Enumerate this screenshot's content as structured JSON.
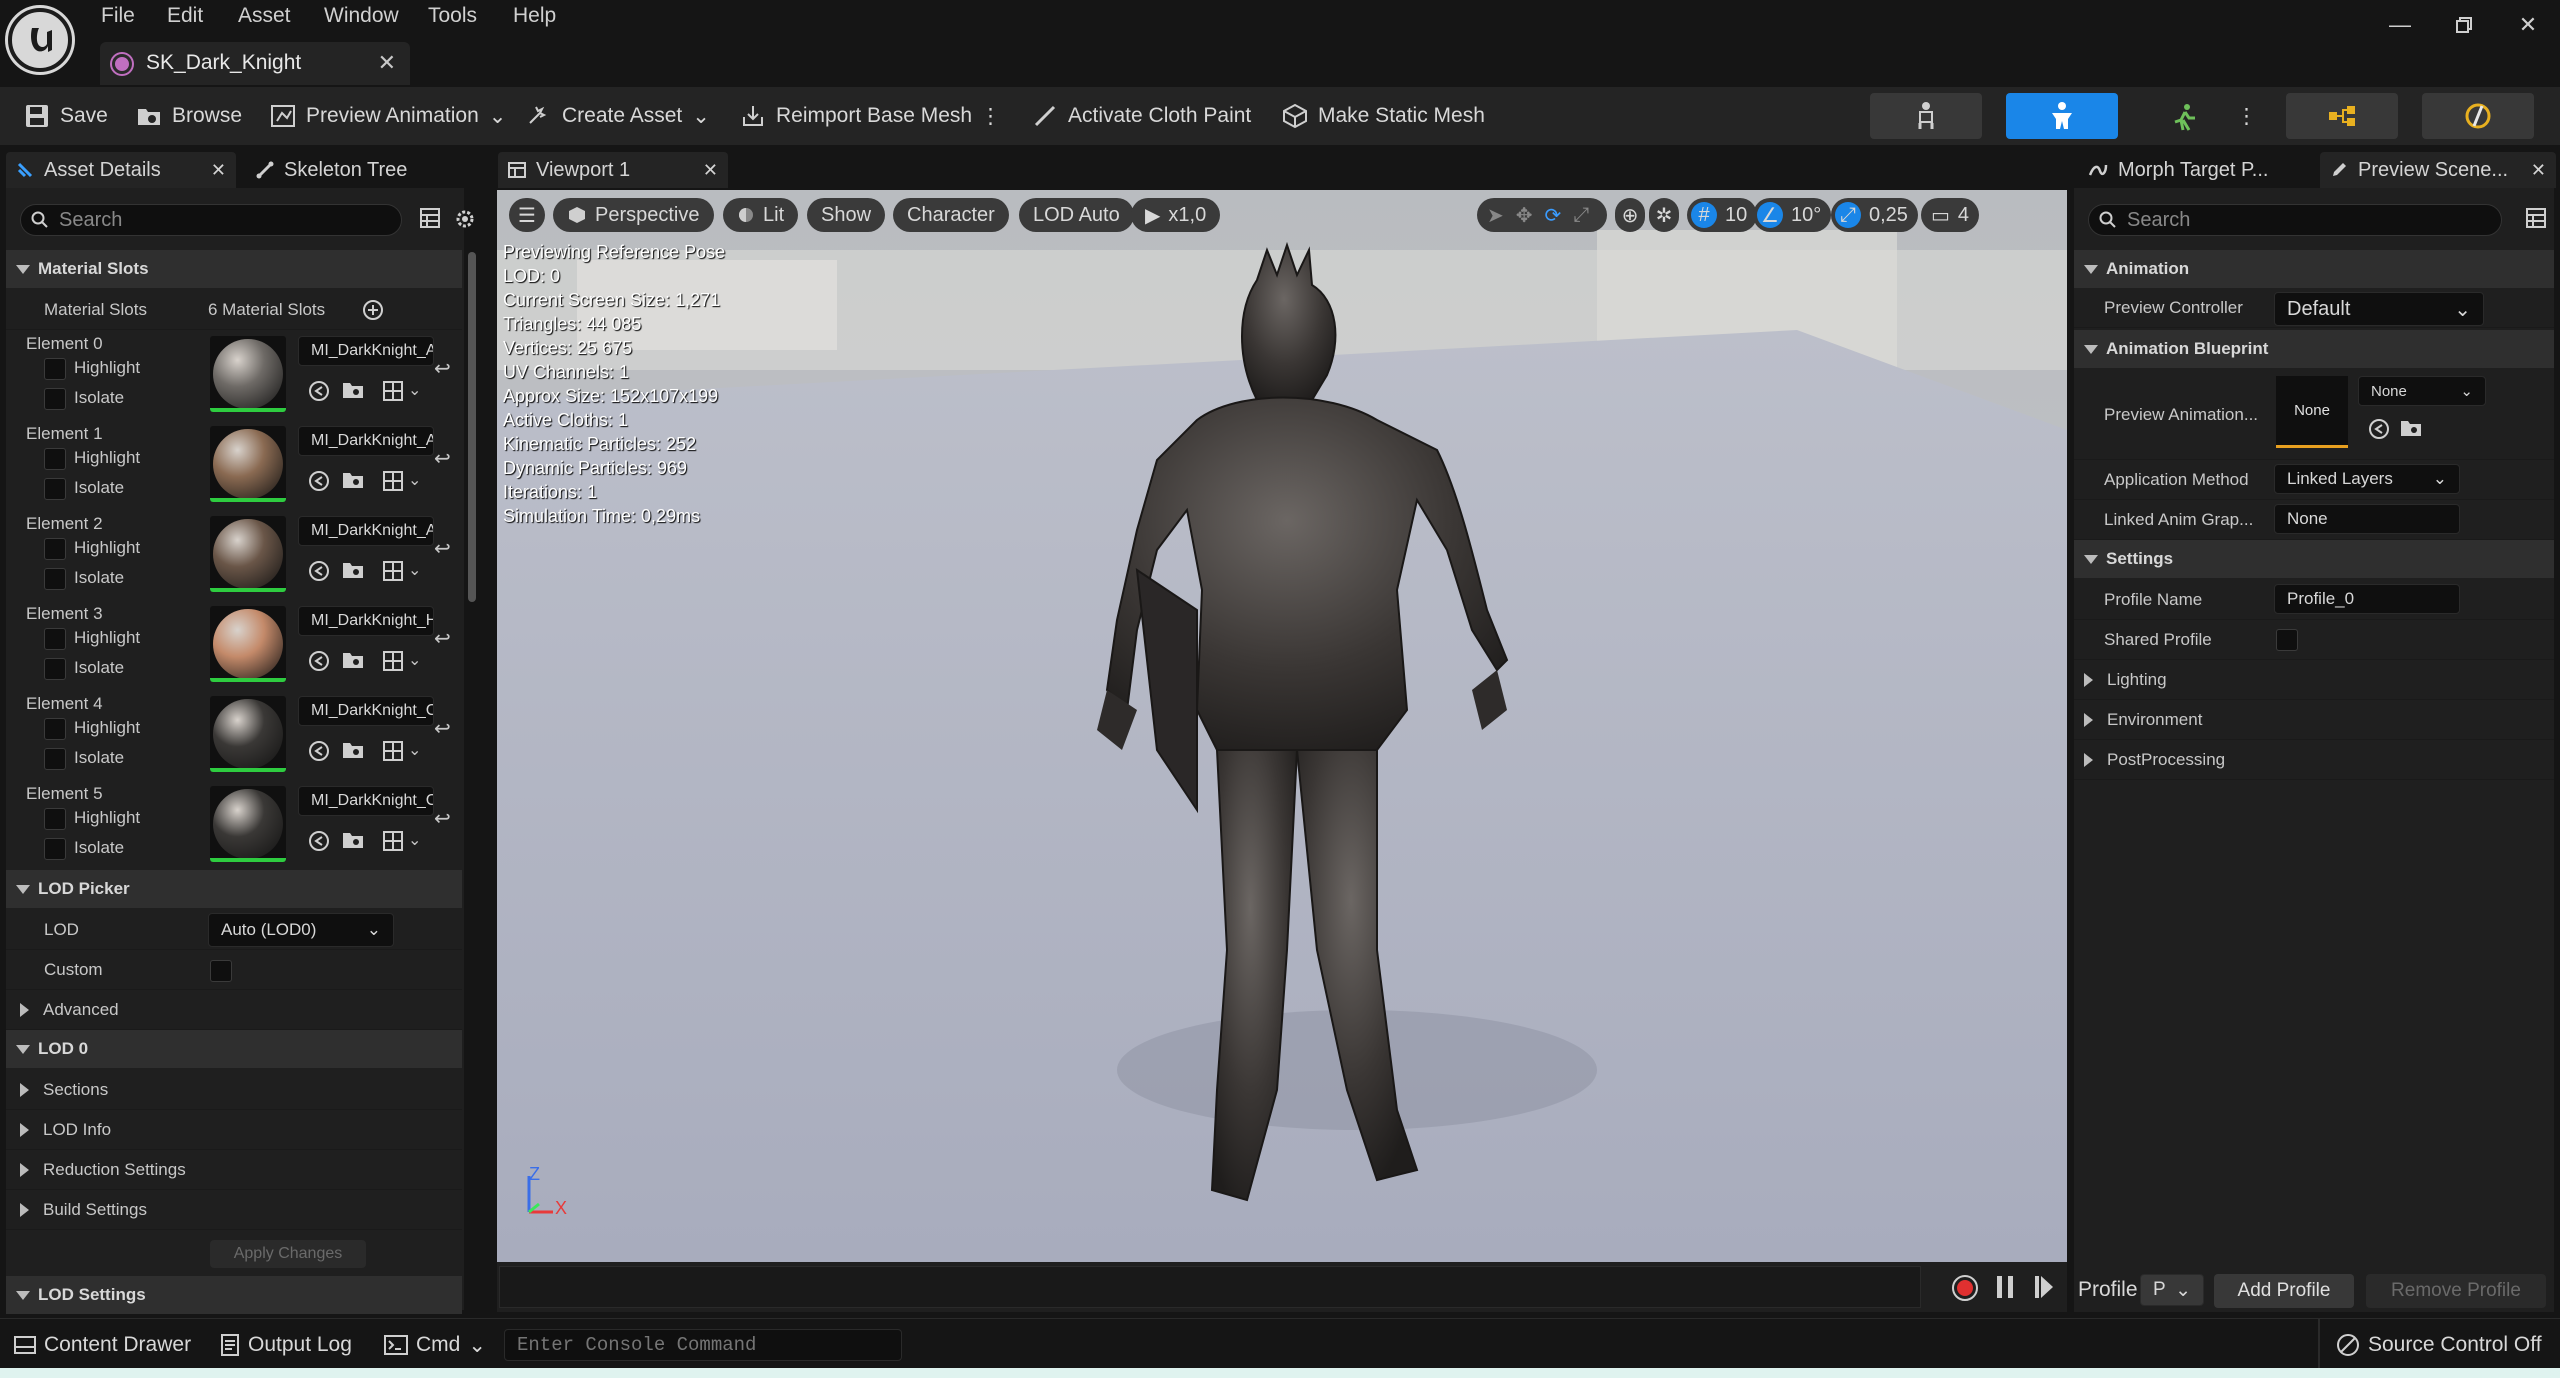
{
  "menu": [
    "File",
    "Edit",
    "Asset",
    "Window",
    "Tools",
    "Help"
  ],
  "document_tab": "SK_Dark_Knight",
  "toolbar": {
    "save": "Save",
    "browse": "Browse",
    "preview_animation": "Preview Animation",
    "create_asset": "Create Asset",
    "reimport": "Reimport Base Mesh",
    "cloth_paint": "Activate Cloth Paint",
    "static_mesh": "Make Static Mesh"
  },
  "left_panel": {
    "tabs": [
      "Asset Details",
      "Skeleton Tree"
    ],
    "search_placeholder": "Search",
    "material_slots_header": "Material Slots",
    "material_slots_label": "Material Slots",
    "material_slots_count": "6 Material Slots",
    "highlight": "Highlight",
    "isolate": "Isolate",
    "elements": [
      {
        "name": "Element 0",
        "material": "MI_DarkKnight_A"
      },
      {
        "name": "Element 1",
        "material": "MI_DarkKnight_A"
      },
      {
        "name": "Element 2",
        "material": "MI_DarkKnight_A"
      },
      {
        "name": "Element 3",
        "material": "MI_DarkKnight_H"
      },
      {
        "name": "Element 4",
        "material": "MI_DarkKnight_C"
      },
      {
        "name": "Element 5",
        "material": "MI_DarkKnight_C"
      }
    ],
    "lod_picker_header": "LOD Picker",
    "lod_label": "LOD",
    "lod_value": "Auto (LOD0)",
    "custom_label": "Custom",
    "advanced": "Advanced",
    "lod0_header": "LOD 0",
    "lod0_rows": [
      "Sections",
      "LOD Info",
      "Reduction Settings",
      "Build Settings"
    ],
    "apply_changes": "Apply Changes",
    "lod_settings_header": "LOD Settings"
  },
  "viewport": {
    "tab": "Viewport 1",
    "perspective": "Perspective",
    "lit": "Lit",
    "show": "Show",
    "character": "Character",
    "lod_auto": "LOD Auto",
    "play_speed": "x1,0",
    "grid_size": "10",
    "rotation_snap": "10°",
    "scale_snap": "0,25",
    "camera_speed": "4",
    "stats": [
      "Previewing Reference Pose",
      "LOD: 0",
      "Current Screen Size: 1,271",
      "Triangles: 44 085",
      "Vertices: 25 675",
      "UV Channels: 1",
      "Approx Size: 152x107x199",
      "Active Cloths: 1",
      "Kinematic Particles: 252",
      "Dynamic Particles: 969",
      "Iterations: 1",
      "Simulation Time: 0,29ms"
    ],
    "axis_z": "Z",
    "axis_x": "X"
  },
  "right_panel": {
    "tabs": [
      "Morph Target P...",
      "Preview Scene..."
    ],
    "search_placeholder": "Search",
    "animation_header": "Animation",
    "preview_controller_label": "Preview Controller",
    "preview_controller_value": "Default",
    "anim_bp_header": "Animation Blueprint",
    "preview_animation_label": "Preview Animation...",
    "preview_animation_thumb": "None",
    "preview_animation_value": "None",
    "application_method_label": "Application Method",
    "application_method_value": "Linked Layers",
    "linked_anim_label": "Linked Anim Grap...",
    "linked_anim_value": "None",
    "settings_header": "Settings",
    "profile_name_label": "Profile Name",
    "profile_name_value": "Profile_0",
    "shared_profile_label": "Shared Profile",
    "collapsed": [
      "Lighting",
      "Environment",
      "PostProcessing"
    ],
    "profile_label": "Profile",
    "profile_select": "P",
    "add_profile": "Add Profile",
    "remove_profile": "Remove Profile"
  },
  "statusbar": {
    "content_drawer": "Content Drawer",
    "output_log": "Output Log",
    "cmd": "Cmd",
    "console_placeholder": "Enter Console Command",
    "source_control": "Source Control Off"
  }
}
